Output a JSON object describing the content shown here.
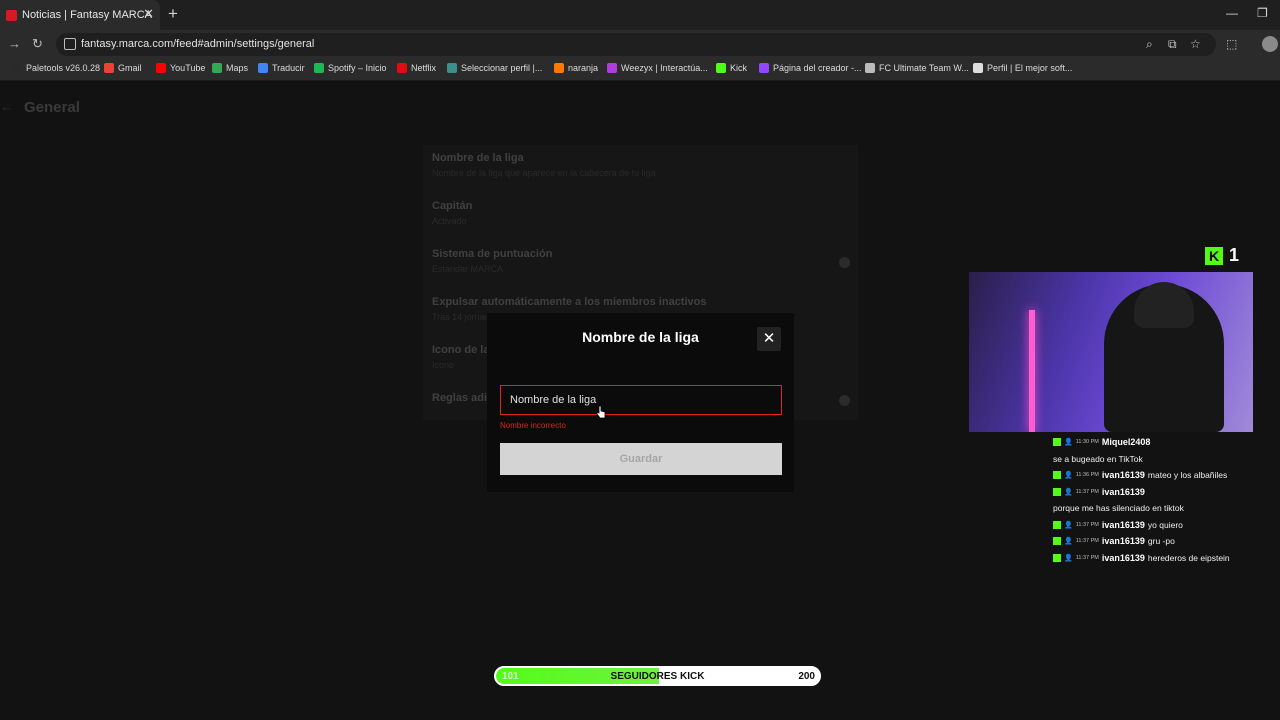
{
  "browser": {
    "tab_title": "Noticias | Fantasy MARCA",
    "url": "fantasy.marca.com/feed#admin/settings/general",
    "bookmarks": [
      {
        "label": "Paletools v26.0.28",
        "color": "#2a2a2a"
      },
      {
        "label": "Gmail",
        "color": "#ea4335"
      },
      {
        "label": "YouTube",
        "color": "#ff0000"
      },
      {
        "label": "Maps",
        "color": "#34a853"
      },
      {
        "label": "Traducir",
        "color": "#4285f4"
      },
      {
        "label": "Spotify – Inicio",
        "color": "#1db954"
      },
      {
        "label": "Netflix",
        "color": "#e50914"
      },
      {
        "label": "Seleccionar perfil |...",
        "color": "#3d8f8f"
      },
      {
        "label": "naranja",
        "color": "#ff7900"
      },
      {
        "label": "Weezyx | Interactúa...",
        "color": "#b03ce0"
      },
      {
        "label": "Kick",
        "color": "#53fc18"
      },
      {
        "label": "Página del creador -...",
        "color": "#9146ff"
      },
      {
        "label": "FC Ultimate Team W...",
        "color": "#bbbbbb"
      },
      {
        "label": "Perfil | El mejor soft...",
        "color": "#dddddd"
      }
    ]
  },
  "page": {
    "title": "General",
    "settings": [
      {
        "label": "Nombre de la liga",
        "value": "Nombre de la liga que aparece en la cabecera de tu liga"
      },
      {
        "label": "Capitán",
        "value": "Activado"
      },
      {
        "label": "Sistema de puntuación",
        "value": "Estándar MARCA"
      },
      {
        "label": "Expulsar automáticamente a los miembros inactivos",
        "value": "Tras 14 jornadas"
      },
      {
        "label": "Icono de la liga",
        "value": "Icono"
      },
      {
        "label": "Reglas adicionales",
        "value": ""
      }
    ]
  },
  "modal": {
    "title": "Nombre de la liga",
    "input_placeholder": "Nombre de la liga",
    "error": "Nombre incorrecto",
    "save_label": "Guardar"
  },
  "stream": {
    "viewer_count": "1",
    "chat": [
      {
        "time": "11:30 PM",
        "user": "Miquel2408",
        "message": ""
      },
      {
        "time": "",
        "user": "",
        "message": "se a bugeado en TikTok"
      },
      {
        "time": "11:36 PM",
        "user": "ivan16139",
        "message": "mateo y los albañiles"
      },
      {
        "time": "11:37 PM",
        "user": "ivan16139",
        "message": ""
      },
      {
        "time": "",
        "user": "",
        "message": "porque me has silenciado en tiktok"
      },
      {
        "time": "11:37 PM",
        "user": "ivan16139",
        "message": "yo quiero"
      },
      {
        "time": "11:37 PM",
        "user": "ivan16139",
        "message": "gru -po"
      },
      {
        "time": "11:37 PM",
        "user": "ivan16139",
        "message": "herederos de eipstein"
      }
    ],
    "goal": {
      "current": "101",
      "label": "SEGUIDORES KICK",
      "max": "200",
      "fraction": 0.505
    }
  },
  "colors": {
    "error": "#e2231a",
    "kick_green": "#53fc18"
  }
}
